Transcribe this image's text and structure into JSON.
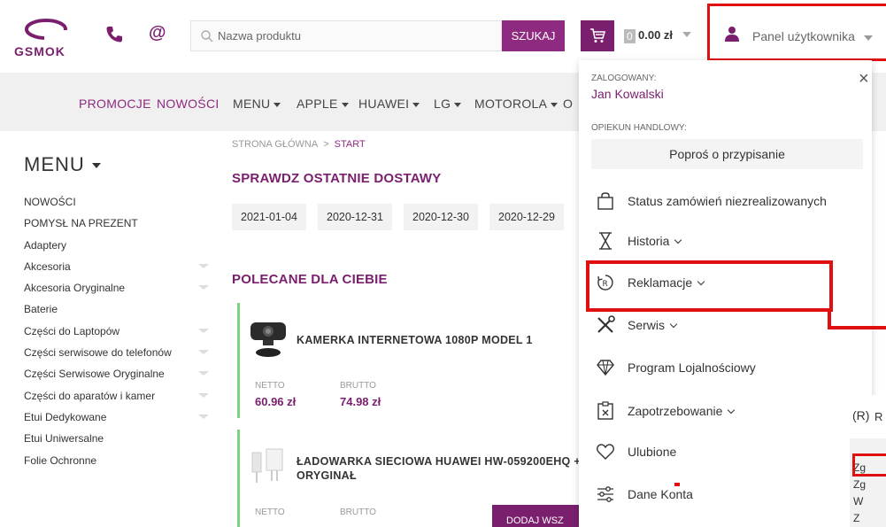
{
  "header": {
    "logo_text": "GSMOK",
    "search_placeholder": "Nazwa produktu",
    "search_button": "SZUKAJ",
    "cart_count": "0",
    "cart_total": "0.00 zł",
    "user_panel_label": "Panel użytkownika"
  },
  "nav": {
    "items": [
      "PROMOCJE",
      "NOWOŚCI",
      "MENU",
      "APPLE",
      "HUAWEI",
      "LG",
      "MOTOROLA",
      "O"
    ]
  },
  "sidebar": {
    "title": "MENU",
    "items": [
      "NOWOŚCI",
      "POMYSŁ NA PREZENT",
      "Adaptery",
      "Akcesoria",
      "Akcesoria Oryginalne",
      "Baterie",
      "Części do Laptopów",
      "Części serwisowe do telefonów",
      "Części Serwisowe Oryginalne",
      "Części do aparatów i kamer",
      "Etui Dedykowane",
      "Etui Uniwersalne",
      "Folie Ochronne"
    ]
  },
  "breadcrumb": {
    "home": "STRONA GŁÓWNA",
    "sep": ">",
    "current": "START"
  },
  "deliveries": {
    "heading": "SPRAWDZ OSTATNIE DOSTAWY",
    "dates": [
      "2021-01-04",
      "2020-12-31",
      "2020-12-30",
      "2020-12-29"
    ]
  },
  "recommended": {
    "heading": "POLECANE DLA CIEBIE",
    "products": [
      {
        "name": "KAMERKA INTERNETOWA 1080P MODEL 1",
        "netto_label": "NETTO",
        "brutto_label": "BRUTTO",
        "netto": "60.96 zł",
        "brutto": "74.98 zł"
      },
      {
        "name_line1": "ŁADOWARKA SIECIOWA HUAWEI HW-059200EHQ +",
        "name_line2": "ORYGINAŁ",
        "netto_label": "NETTO",
        "brutto_label": "BRUTTO"
      }
    ],
    "add_all_button": "DODAJ WSZ"
  },
  "dropdown": {
    "logged_in_label": "ZALOGOWANY:",
    "user_name": "Jan Kowalski",
    "close": "×",
    "account_manager_label": "OPIEKUN HANDLOWY:",
    "assign_button": "Poproś o przypisanie",
    "items": [
      "Status zamówień niezrealizowanych",
      "Historia",
      "Reklamacje",
      "Serwis",
      "Program Lojalnościowy",
      "Zapotrzebowanie",
      "Ulubione",
      "Dane Konta"
    ]
  },
  "subpanel": {
    "icon_letter": "(R)",
    "first_letter": "R",
    "lines": [
      "Zg",
      "Zg",
      "W",
      "Z"
    ]
  },
  "colors": {
    "brand": "#7a1f6e",
    "highlight": "#e01010",
    "accent_green": "#7dd37d"
  }
}
